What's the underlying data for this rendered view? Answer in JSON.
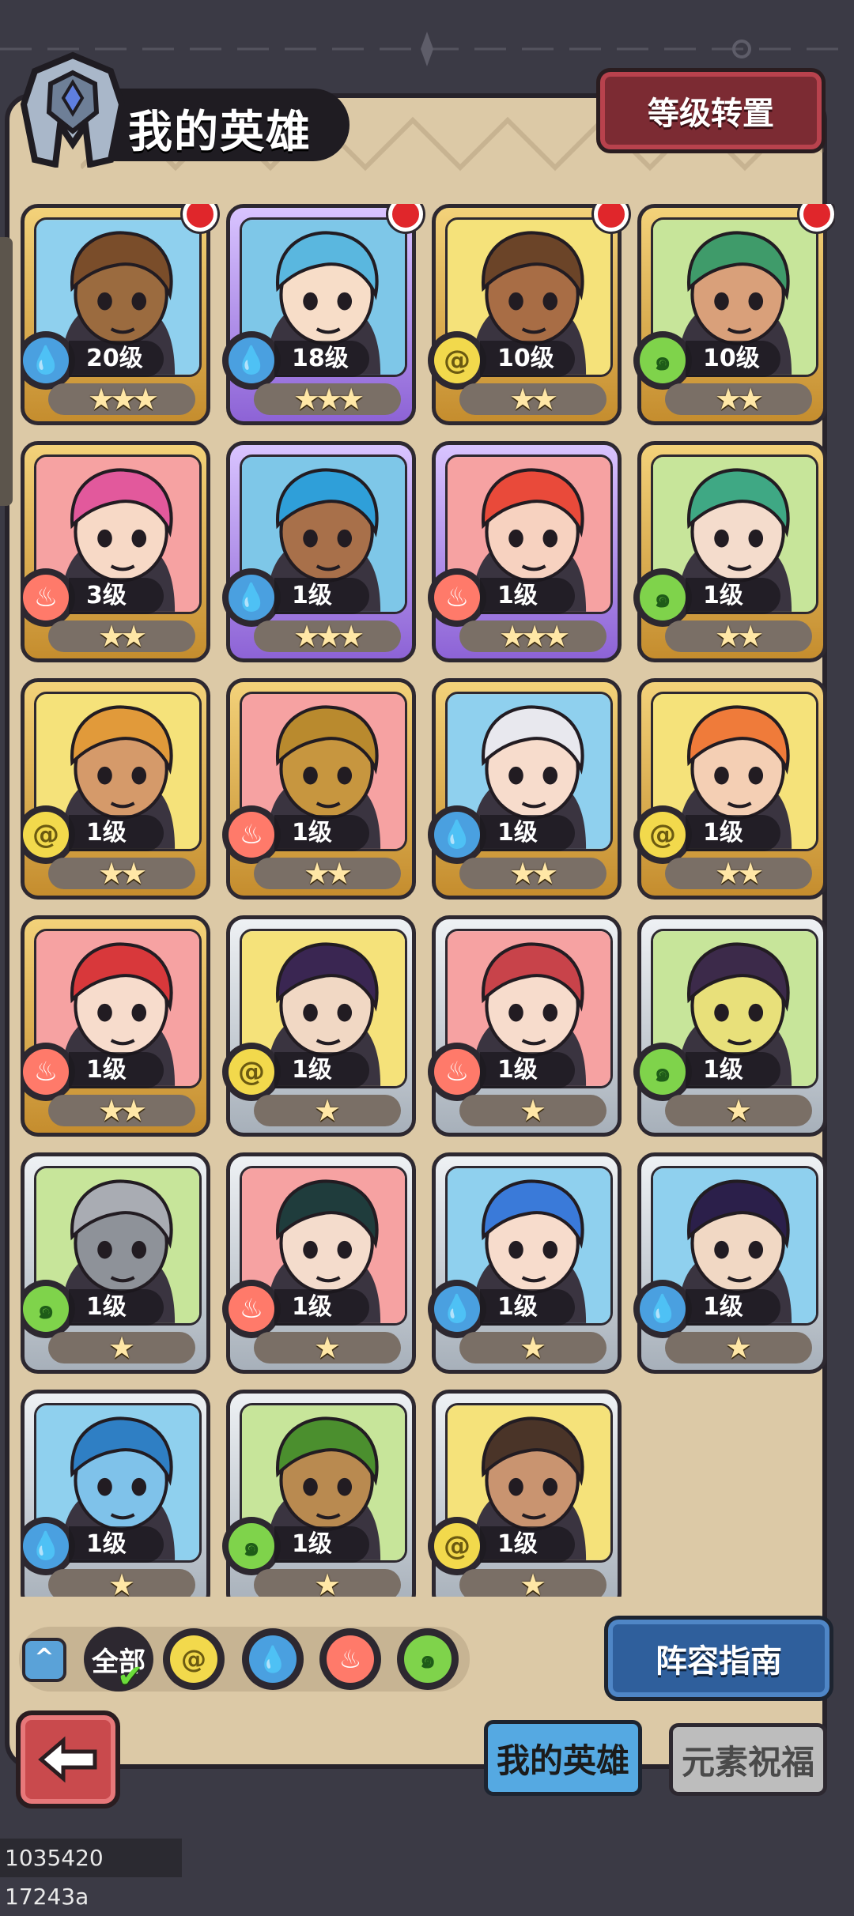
{
  "header": {
    "title": "我的英雄",
    "level_transfer_label": "等级转置"
  },
  "heroes": [
    {
      "level": "20级",
      "stars": "★★★",
      "star_count": 3,
      "element": "water",
      "frame": "gold",
      "new_badge": true,
      "bg": "#8fd0ee",
      "hair": "#7a4d2a",
      "skin": "#9b6b3f"
    },
    {
      "level": "18级",
      "stars": "★★★",
      "star_count": 3,
      "element": "water",
      "frame": "purple",
      "new_badge": true,
      "bg": "#7ec7e8",
      "hair": "#5ab7df",
      "skin": "#f7ddc8"
    },
    {
      "level": "10级",
      "stars": "★★",
      "star_count": 2,
      "element": "earth",
      "frame": "gold",
      "new_badge": true,
      "bg": "#f5e27a",
      "hair": "#6b4428",
      "skin": "#a86d45"
    },
    {
      "level": "10级",
      "stars": "★★",
      "star_count": 2,
      "element": "wind",
      "frame": "gold",
      "new_badge": true,
      "bg": "#c7e59a",
      "hair": "#3f9b6a",
      "skin": "#d9a07a"
    },
    {
      "level": "3级",
      "stars": "★★",
      "star_count": 2,
      "element": "fire",
      "frame": "gold",
      "new_badge": false,
      "bg": "#f6a2a2",
      "hair": "#e2599c",
      "skin": "#f7d9c6"
    },
    {
      "level": "1级",
      "stars": "★★★",
      "star_count": 3,
      "element": "water",
      "frame": "purple",
      "new_badge": false,
      "bg": "#7ec7e8",
      "hair": "#2f9fd9",
      "skin": "#a8704a"
    },
    {
      "level": "1级",
      "stars": "★★★",
      "star_count": 3,
      "element": "fire",
      "frame": "purple",
      "new_badge": false,
      "bg": "#f6a2a2",
      "hair": "#e94a3a",
      "skin": "#f7d2c0"
    },
    {
      "level": "1级",
      "stars": "★★",
      "star_count": 2,
      "element": "wind",
      "frame": "gold",
      "new_badge": false,
      "bg": "#c7e59a",
      "hair": "#3fa884",
      "skin": "#f4dccc"
    },
    {
      "level": "1级",
      "stars": "★★",
      "star_count": 2,
      "element": "earth",
      "frame": "gold",
      "new_badge": false,
      "bg": "#f5e27a",
      "hair": "#e19a3a",
      "skin": "#d59a6a"
    },
    {
      "level": "1级",
      "stars": "★★",
      "star_count": 2,
      "element": "fire",
      "frame": "gold",
      "new_badge": false,
      "bg": "#f6a2a2",
      "hair": "#b98a2e",
      "skin": "#c7963f"
    },
    {
      "level": "1级",
      "stars": "★★",
      "star_count": 2,
      "element": "water",
      "frame": "gold",
      "new_badge": false,
      "bg": "#8fd0ee",
      "hair": "#e8e8ee",
      "skin": "#f7dccc"
    },
    {
      "level": "1级",
      "stars": "★★",
      "star_count": 2,
      "element": "earth",
      "frame": "gold",
      "new_badge": false,
      "bg": "#f5e27a",
      "hair": "#ef7b3a",
      "skin": "#f4cfb4"
    },
    {
      "level": "1级",
      "stars": "★★",
      "star_count": 2,
      "element": "fire",
      "frame": "gold",
      "new_badge": false,
      "bg": "#f6a2a2",
      "hair": "#d8383b",
      "skin": "#f7dccc"
    },
    {
      "level": "1级",
      "stars": "★",
      "star_count": 1,
      "element": "earth",
      "frame": "silver",
      "new_badge": false,
      "bg": "#f5e27a",
      "hair": "#3a2652",
      "skin": "#f1d8c4"
    },
    {
      "level": "1级",
      "stars": "★",
      "star_count": 1,
      "element": "fire",
      "frame": "silver",
      "new_badge": false,
      "bg": "#f6a2a2",
      "hair": "#c8434a",
      "skin": "#f7dccc"
    },
    {
      "level": "1级",
      "stars": "★",
      "star_count": 1,
      "element": "wind",
      "frame": "silver",
      "new_badge": false,
      "bg": "#c7e59a",
      "hair": "#3c2a4a",
      "skin": "#e8e07a"
    },
    {
      "level": "1级",
      "stars": "★",
      "star_count": 1,
      "element": "wind",
      "frame": "silver",
      "new_badge": false,
      "bg": "#c7e59a",
      "hair": "#a9acb3",
      "skin": "#8e9299"
    },
    {
      "level": "1级",
      "stars": "★",
      "star_count": 1,
      "element": "fire",
      "frame": "silver",
      "new_badge": false,
      "bg": "#f6a2a2",
      "hair": "#1f3c3c",
      "skin": "#f4dccc"
    },
    {
      "level": "1级",
      "stars": "★",
      "star_count": 1,
      "element": "water",
      "frame": "silver",
      "new_badge": false,
      "bg": "#8fd0ee",
      "hair": "#3a7ad9",
      "skin": "#f7dccc"
    },
    {
      "level": "1级",
      "stars": "★",
      "star_count": 1,
      "element": "water",
      "frame": "silver",
      "new_badge": false,
      "bg": "#8fd0ee",
      "hair": "#2b1f4a",
      "skin": "#f1d8c4"
    },
    {
      "level": "1级",
      "stars": "★",
      "star_count": 1,
      "element": "water",
      "frame": "silver",
      "new_badge": false,
      "bg": "#8fd0ee",
      "hair": "#2f7fc4",
      "skin": "#7fc2ea"
    },
    {
      "level": "1级",
      "stars": "★",
      "star_count": 1,
      "element": "wind",
      "frame": "silver",
      "new_badge": false,
      "bg": "#c7e59a",
      "hair": "#4b8f2e",
      "skin": "#b98a50"
    },
    {
      "level": "1级",
      "stars": "★",
      "star_count": 1,
      "element": "earth",
      "frame": "silver",
      "new_badge": false,
      "bg": "#f5e27a",
      "hair": "#4a3428",
      "skin": "#c99470"
    }
  ],
  "filters": {
    "collapse_icon": "^",
    "all_label": "全部",
    "all_checked": true,
    "elements": [
      "earth",
      "water",
      "fire",
      "wind"
    ]
  },
  "lineup_guide_label": "阵容指南",
  "tabs": {
    "my_heroes": "我的英雄",
    "element_blessing": "元素祝福"
  },
  "footer_id": "1035420 17243a",
  "colors": {
    "water": "#4aa0e0",
    "fire": "#ff7a6a",
    "earth": "#f2d94c",
    "wind": "#7fd34b"
  }
}
